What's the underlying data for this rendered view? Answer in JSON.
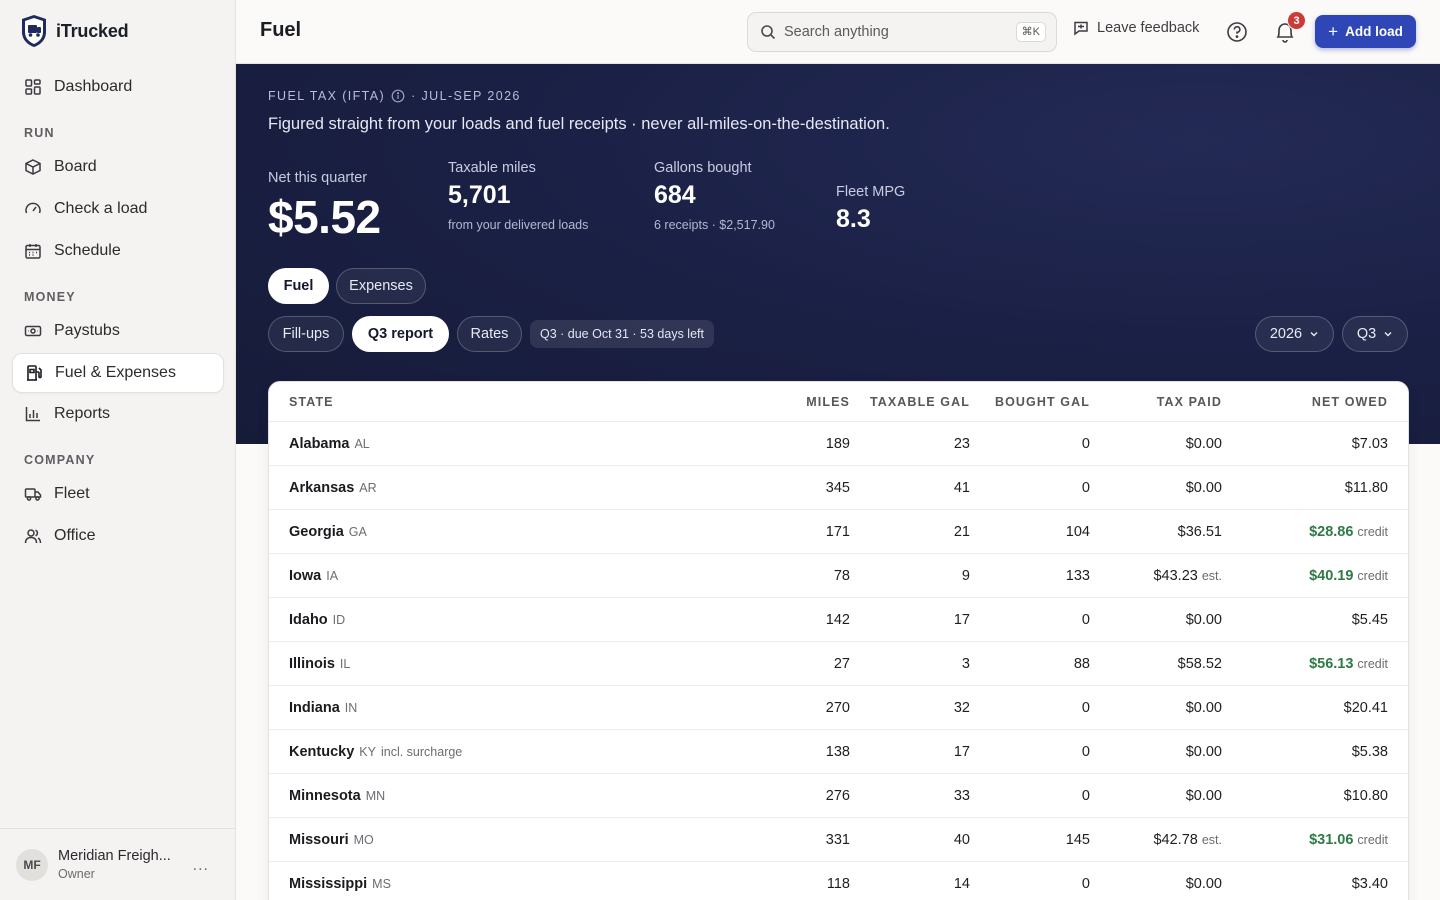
{
  "app": {
    "name": "iTrucked"
  },
  "sidebar": {
    "dashboard": "Dashboard",
    "sections": {
      "run": "RUN",
      "money": "MONEY",
      "company": "COMPANY"
    },
    "board": "Board",
    "check_load": "Check a load",
    "schedule": "Schedule",
    "paystubs": "Paystubs",
    "fuel_expenses": "Fuel & Expenses",
    "reports": "Reports",
    "fleet": "Fleet",
    "office": "Office",
    "user": {
      "initials": "MF",
      "name": "Meridian Freigh...",
      "role": "Owner",
      "more": "..."
    }
  },
  "topbar": {
    "title": "Fuel",
    "search_placeholder": "Search anything",
    "search_shortcut": "⌘K",
    "feedback": "Leave feedback",
    "notifications_count": "3",
    "add_load": "Add load"
  },
  "hero": {
    "kicker": "FUEL TAX (IFTA)",
    "period": "· JUL-SEP 2026",
    "subtitle": "Figured straight from your loads and fuel receipts · never all-miles-on-the-destination.",
    "net_label": "Net this quarter",
    "net_value": "$5.52",
    "miles_label": "Taxable miles",
    "miles_value": "5,701",
    "miles_foot": "from your delivered loads",
    "gallons_label": "Gallons bought",
    "gallons_value": "684",
    "gallons_foot": "6 receipts · $2,517.90",
    "mpg_label": "Fleet MPG",
    "mpg_value": "8.3"
  },
  "tabs": {
    "fuel": "Fuel",
    "expenses": "Expenses"
  },
  "subtabs": {
    "fillups": "Fill-ups",
    "q3_report": "Q3 report",
    "rates": "Rates"
  },
  "due_chip": "Q3 · due Oct 31 · 53 days left",
  "filters": {
    "year": "2026",
    "quarter": "Q3"
  },
  "table": {
    "headers": {
      "state": "STATE",
      "miles": "MILES",
      "taxable_gal": "TAXABLE GAL",
      "bought_gal": "BOUGHT GAL",
      "tax_paid": "TAX PAID",
      "net_owed": "NET OWED"
    },
    "rows": [
      {
        "state": "Alabama",
        "abbr": "AL",
        "note": "",
        "miles": "189",
        "taxable": "23",
        "bought": "0",
        "paid": "$0.00",
        "paid_note": "",
        "net": "$7.03",
        "credit": false
      },
      {
        "state": "Arkansas",
        "abbr": "AR",
        "note": "",
        "miles": "345",
        "taxable": "41",
        "bought": "0",
        "paid": "$0.00",
        "paid_note": "",
        "net": "$11.80",
        "credit": false
      },
      {
        "state": "Georgia",
        "abbr": "GA",
        "note": "",
        "miles": "171",
        "taxable": "21",
        "bought": "104",
        "paid": "$36.51",
        "paid_note": "",
        "net": "$28.86",
        "credit": true
      },
      {
        "state": "Iowa",
        "abbr": "IA",
        "note": "",
        "miles": "78",
        "taxable": "9",
        "bought": "133",
        "paid": "$43.23",
        "paid_note": "est.",
        "net": "$40.19",
        "credit": true
      },
      {
        "state": "Idaho",
        "abbr": "ID",
        "note": "",
        "miles": "142",
        "taxable": "17",
        "bought": "0",
        "paid": "$0.00",
        "paid_note": "",
        "net": "$5.45",
        "credit": false
      },
      {
        "state": "Illinois",
        "abbr": "IL",
        "note": "",
        "miles": "27",
        "taxable": "3",
        "bought": "88",
        "paid": "$58.52",
        "paid_note": "",
        "net": "$56.13",
        "credit": true
      },
      {
        "state": "Indiana",
        "abbr": "IN",
        "note": "",
        "miles": "270",
        "taxable": "32",
        "bought": "0",
        "paid": "$0.00",
        "paid_note": "",
        "net": "$20.41",
        "credit": false
      },
      {
        "state": "Kentucky",
        "abbr": "KY",
        "note": "incl. surcharge",
        "miles": "138",
        "taxable": "17",
        "bought": "0",
        "paid": "$0.00",
        "paid_note": "",
        "net": "$5.38",
        "credit": false
      },
      {
        "state": "Minnesota",
        "abbr": "MN",
        "note": "",
        "miles": "276",
        "taxable": "33",
        "bought": "0",
        "paid": "$0.00",
        "paid_note": "",
        "net": "$10.80",
        "credit": false
      },
      {
        "state": "Missouri",
        "abbr": "MO",
        "note": "",
        "miles": "331",
        "taxable": "40",
        "bought": "145",
        "paid": "$42.78",
        "paid_note": "est.",
        "net": "$31.06",
        "credit": true
      },
      {
        "state": "Mississippi",
        "abbr": "MS",
        "note": "",
        "miles": "118",
        "taxable": "14",
        "bought": "0",
        "paid": "$0.00",
        "paid_note": "",
        "net": "$3.40",
        "credit": false
      }
    ],
    "credit_label": "credit"
  }
}
